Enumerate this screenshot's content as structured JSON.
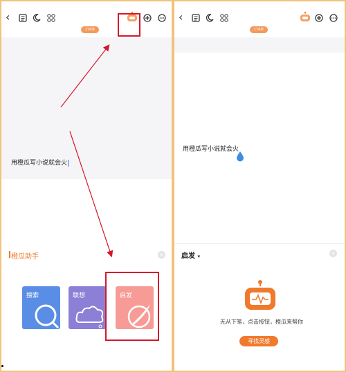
{
  "left_panel": {
    "toolbar": {
      "back_icon": "chevron-left-icon",
      "outline_icon": "list-doc-icon",
      "night_icon": "moon-icon",
      "grid_icon": "grid-icon",
      "badge_label": "174字",
      "assistant_icon": "orange-robot-icon",
      "add_icon": "plus-circle-icon",
      "more_icon": "more-circle-icon"
    },
    "document_text": "用橙瓜写小说就会火",
    "assistant_title": "橙瓜助手",
    "cards": [
      {
        "label": "搜索",
        "icon": "search-icon",
        "color": "#5a8ee6"
      },
      {
        "label": "联想",
        "icon": "cloud-icon",
        "color": "#8b7fd6"
      },
      {
        "label": "启发",
        "icon": "quill-icon",
        "color": "#f79b96"
      }
    ]
  },
  "right_panel": {
    "toolbar": {
      "badge_label": "174字"
    },
    "document_text": "用橙瓜写小说就会火",
    "section_title": "启发",
    "hint_text": "无从下笔，点击按钮，橙瓜来帮你",
    "find_button_label": "寻找灵感"
  },
  "colors": {
    "accent": "#f07a2c",
    "annotation_red": "#d5172a",
    "border": "#f0c27a"
  }
}
